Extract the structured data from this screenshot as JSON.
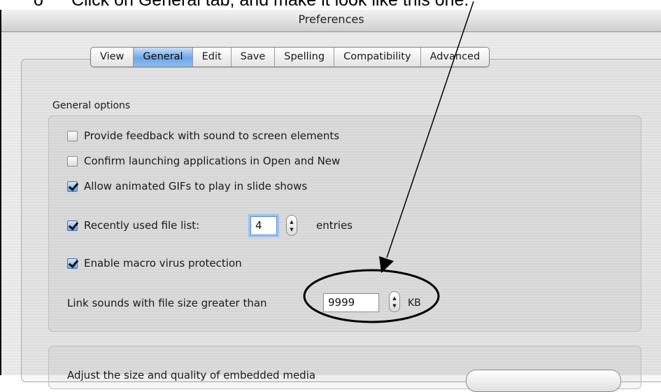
{
  "instruction": {
    "bullet": "o",
    "text": "Click on General tab, and make it look like this one."
  },
  "window": {
    "title": "Preferences"
  },
  "tabs": [
    {
      "label": "View",
      "active": false
    },
    {
      "label": "General",
      "active": true
    },
    {
      "label": "Edit",
      "active": false
    },
    {
      "label": "Save",
      "active": false
    },
    {
      "label": "Spelling",
      "active": false
    },
    {
      "label": "Compatibility",
      "active": false
    },
    {
      "label": "Advanced",
      "active": false
    }
  ],
  "general_options": {
    "label": "General options",
    "feedback_sound": {
      "label": "Provide feedback with sound to screen elements",
      "checked": false
    },
    "confirm_launching": {
      "label": "Confirm launching applications in Open and New",
      "checked": false
    },
    "animated_gifs": {
      "label": "Allow animated GIFs to play in slide shows",
      "checked": true
    },
    "recent_files": {
      "label": "Recently used file list:",
      "checked": true,
      "value": "4",
      "suffix": "entries"
    },
    "macro_protection": {
      "label": "Enable macro virus protection",
      "checked": true
    },
    "link_sounds": {
      "label": "Link sounds with file size greater than",
      "value": "9999",
      "unit": "KB"
    }
  },
  "second_group": {
    "text": "Adjust the size and quality of embedded media"
  },
  "annotation": {
    "color": "#000000"
  },
  "icons": {
    "stepper": "stepper-arrows-icon",
    "checkmark": "checkmark-icon"
  }
}
